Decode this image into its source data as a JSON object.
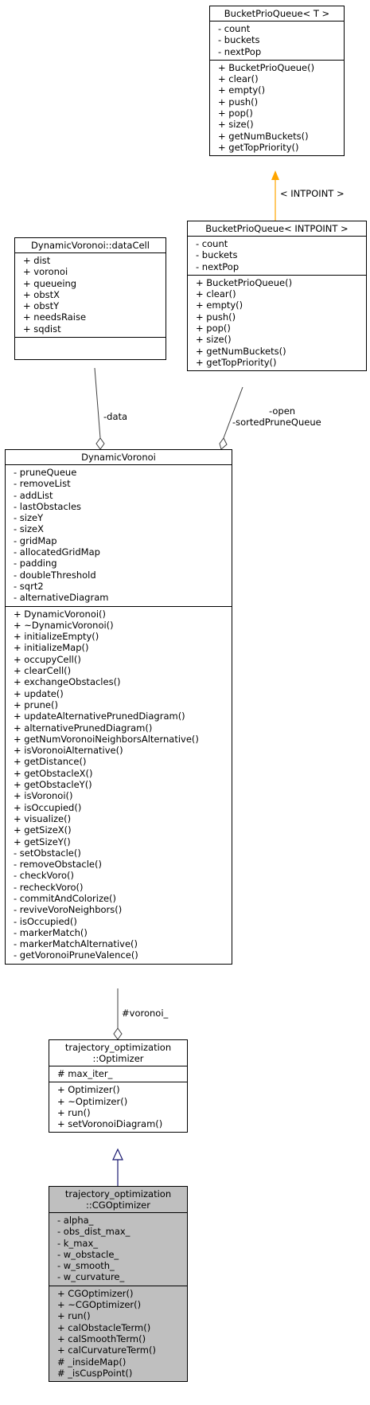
{
  "nodes": {
    "bucket_t": {
      "title": [
        "BucketPrioQueue< T >"
      ],
      "attributes": [
        "- count",
        "- buckets",
        "- nextPop"
      ],
      "methods": [
        "+ BucketPrioQueue()",
        "+ clear()",
        "+ empty()",
        "+ push()",
        "+ pop()",
        "+ size()",
        "+ getNumBuckets()",
        "+ getTopPriority()"
      ]
    },
    "bucket_intpoint": {
      "title": [
        "BucketPrioQueue< INTPOINT >"
      ],
      "attributes": [
        "- count",
        "- buckets",
        "- nextPop"
      ],
      "methods": [
        "+ BucketPrioQueue()",
        "+ clear()",
        "+ empty()",
        "+ push()",
        "+ pop()",
        "+ size()",
        "+ getNumBuckets()",
        "+ getTopPriority()"
      ]
    },
    "datacell": {
      "title": [
        "DynamicVoronoi::dataCell"
      ],
      "attributes": [
        "+ dist",
        "+ voronoi",
        "+ queueing",
        "+ obstX",
        "+ obstY",
        "+ needsRaise",
        "+ sqdist"
      ],
      "methods": []
    },
    "dynamicvoronoi": {
      "title": [
        "DynamicVoronoi"
      ],
      "attributes": [
        "- pruneQueue",
        "- removeList",
        "- addList",
        "- lastObstacles",
        "- sizeY",
        "- sizeX",
        "- gridMap",
        "- allocatedGridMap",
        "- padding",
        "- doubleThreshold",
        "- sqrt2",
        "- alternativeDiagram"
      ],
      "methods": [
        "+ DynamicVoronoi()",
        "+ ~DynamicVoronoi()",
        "+ initializeEmpty()",
        "+ initializeMap()",
        "+ occupyCell()",
        "+ clearCell()",
        "+ exchangeObstacles()",
        "+ update()",
        "+ prune()",
        "+ updateAlternativePrunedDiagram()",
        "+ alternativePrunedDiagram()",
        "+ getNumVoronoiNeighborsAlternative()",
        "+ isVoronoiAlternative()",
        "+ getDistance()",
        "+ getObstacleX()",
        "+ getObstacleY()",
        "+ isVoronoi()",
        "+ isOccupied()",
        "+ visualize()",
        "+ getSizeX()",
        "+ getSizeY()",
        "- setObstacle()",
        "- removeObstacle()",
        "- checkVoro()",
        "- recheckVoro()",
        "- commitAndColorize()",
        "- reviveVoroNeighbors()",
        "- isOccupied()",
        "- markerMatch()",
        "- markerMatchAlternative()",
        "- getVoronoiPruneValence()"
      ]
    },
    "optimizer": {
      "title": [
        "trajectory_optimization",
        "::Optimizer"
      ],
      "attributes": [
        "# max_iter_"
      ],
      "methods": [
        "+ Optimizer()",
        "+ ~Optimizer()",
        "+ run()",
        "+ setVoronoiDiagram()"
      ]
    },
    "cgoptimizer": {
      "title": [
        "trajectory_optimization",
        "::CGOptimizer"
      ],
      "attributes": [
        "- alpha_",
        "- obs_dist_max_",
        "- k_max_",
        "- w_obstacle_",
        "- w_smooth_",
        "- w_curvature_"
      ],
      "methods": [
        "+ CGOptimizer()",
        "+ ~CGOptimizer()",
        "+ run()",
        "+ calObstacleTerm()",
        "+ calSmoothTerm()",
        "+ calCurvatureTerm()",
        "# _insideMap()",
        "# _isCuspPoint()"
      ]
    }
  },
  "edge_labels": {
    "template": "< INTPOINT >",
    "data": "-data",
    "open": "-open",
    "sorted": "-sortedPruneQueue",
    "voronoi": "#voronoi_"
  },
  "colors": {
    "template_edge": "#FFA500",
    "inheritance_edge": "#191970",
    "association_edge": "#404040",
    "highlight_fill": "#bfbfbf"
  }
}
